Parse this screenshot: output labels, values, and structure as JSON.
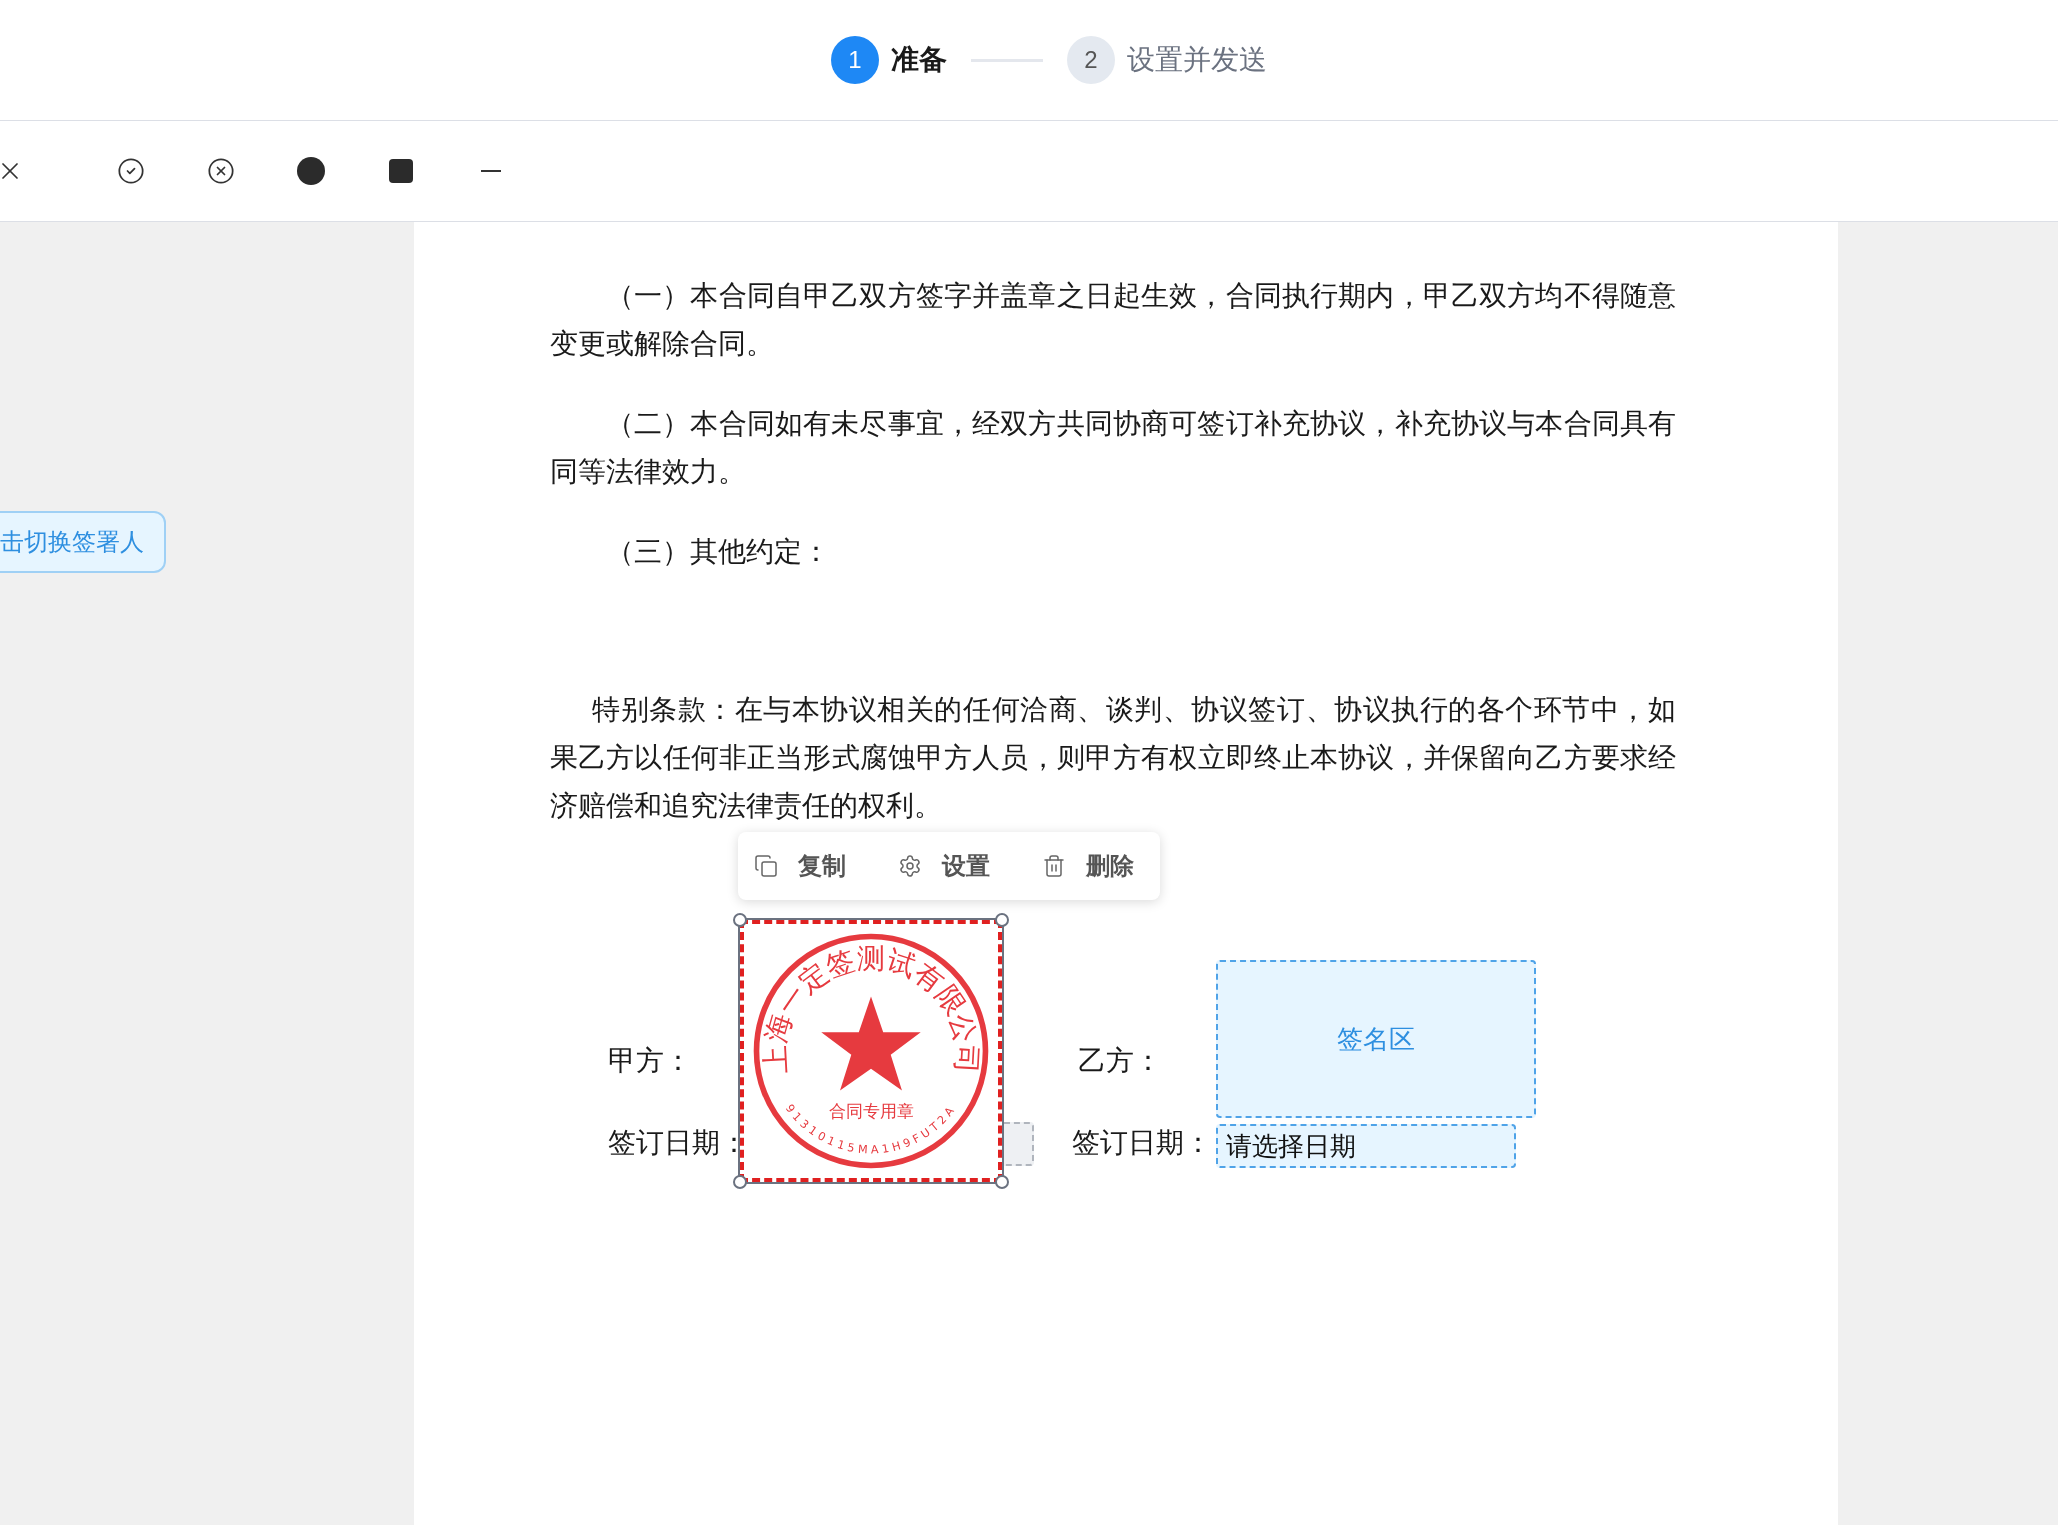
{
  "steps": [
    {
      "number": "1",
      "label": "准备",
      "selected": true
    },
    {
      "number": "2",
      "label": "设置并发送",
      "selected": false
    }
  ],
  "toolbar": {
    "tools": [
      {
        "kind": "close"
      },
      {
        "kind": "check-circle"
      },
      {
        "kind": "x-circle"
      },
      {
        "kind": "dot"
      },
      {
        "kind": "square"
      },
      {
        "kind": "dash"
      }
    ]
  },
  "switch_signer_button": "击切换签署人",
  "document": {
    "paragraphs": [
      "（一）本合同自甲乙双方签字并盖章之日起生效，合同执行期内，甲乙双方均不得随意变更或解除合同。",
      "（二）本合同如有未尽事宜，经双方共同协商可签订补充协议，补充协议与本合同具有同等法律效力。",
      "（三）其他约定：",
      "特别条款：在与本协议相关的任何洽商、谈判、协议签订、协议执行的各个环节中，如果乙方以任何非正当形式腐蚀甲方人员，则甲方有权立即终止本协议，并保留向乙方要求经济赔偿和追究法律责任的权利。"
    ]
  },
  "parties": [
    {
      "label": "甲方：",
      "date_label": "签订日期："
    },
    {
      "label": "乙方：",
      "date_label": "签订日期："
    }
  ],
  "stamp": {
    "selected": true,
    "company": "上海一定签测试有限公司",
    "title": "合同专用章",
    "code": "91310115MA1H9FUT2A"
  },
  "stamp_toolbar": [
    {
      "kind": "copy",
      "label": "复制"
    },
    {
      "kind": "settings",
      "label": "设置"
    },
    {
      "kind": "delete",
      "label": "删除"
    }
  ],
  "signature_area": {
    "label": "签名区"
  },
  "date_field": {
    "placeholder": "请选择日期"
  }
}
